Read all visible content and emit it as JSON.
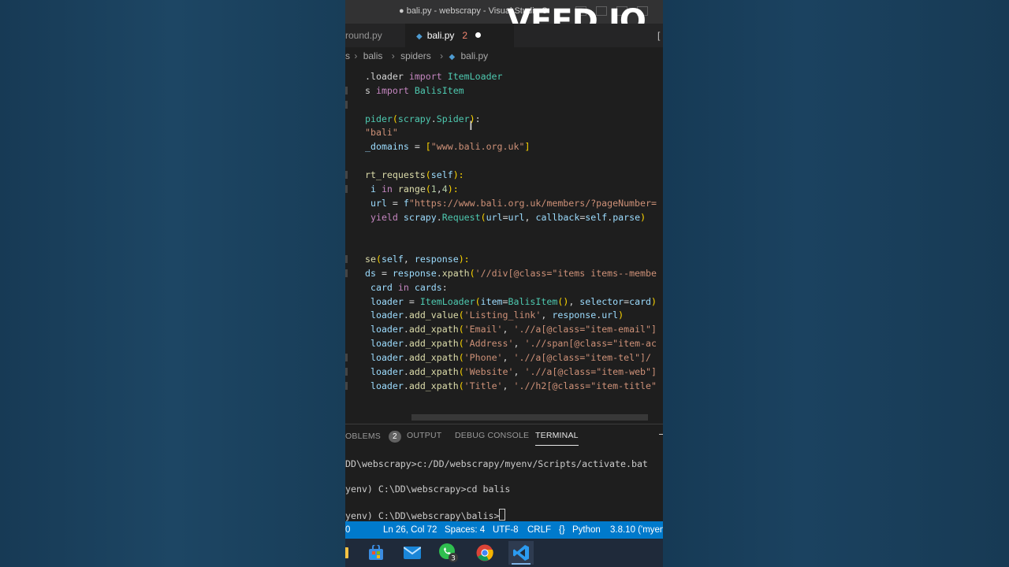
{
  "window": {
    "title": "● bali.py - webscrapy - Visual Studio C",
    "watermark": "VEED.IO"
  },
  "tabs": [
    {
      "label": "round.py",
      "active": false
    },
    {
      "label": "bali.py",
      "active": true,
      "errors": "2",
      "modified": true
    }
  ],
  "tab_overflow_glyph": "[",
  "breadcrumb": {
    "leading": "s",
    "parts": [
      "balis",
      "spiders",
      "bali.py"
    ]
  },
  "editor": {
    "lines": [
      [
        [
          ".loader ",
          "p"
        ],
        [
          "import ",
          "kw"
        ],
        [
          "ItemLoader",
          "cls"
        ]
      ],
      [
        [
          "s ",
          "p"
        ],
        [
          "import ",
          "kw"
        ],
        [
          "BalisItem",
          "cls"
        ]
      ],
      [],
      [
        [
          "pider",
          "cls"
        ],
        [
          "(",
          "y"
        ],
        [
          "scrapy",
          "cls"
        ],
        [
          ".",
          "p"
        ],
        [
          "Spider",
          "cls"
        ],
        [
          ")",
          "y"
        ],
        [
          ":",
          "p"
        ]
      ],
      [
        [
          "\"bali\"",
          "str"
        ]
      ],
      [
        [
          "_domains ",
          "var"
        ],
        [
          "= ",
          "p"
        ],
        [
          "[",
          "y"
        ],
        [
          "\"www.bali.org.uk\"",
          "str"
        ],
        [
          "]",
          "y"
        ]
      ],
      [],
      [
        [
          "rt_requests",
          "fn"
        ],
        [
          "(",
          "y"
        ],
        [
          "self",
          "var"
        ],
        [
          "):",
          "y"
        ]
      ],
      [
        [
          " i ",
          "var"
        ],
        [
          "in ",
          "kw"
        ],
        [
          "range",
          "fn"
        ],
        [
          "(",
          "y"
        ],
        [
          "1",
          "num"
        ],
        [
          ",",
          "p"
        ],
        [
          "4",
          "num"
        ],
        [
          "):",
          "y"
        ]
      ],
      [
        [
          " url ",
          "var"
        ],
        [
          "= ",
          "p"
        ],
        [
          "f",
          "var"
        ],
        [
          "\"https://www.bali.org.uk/members/?pageNumber=",
          "str"
        ]
      ],
      [
        [
          " yield ",
          "kw"
        ],
        [
          "scrapy",
          "var"
        ],
        [
          ".",
          "p"
        ],
        [
          "Request",
          "cls"
        ],
        [
          "(",
          "y"
        ],
        [
          "url",
          "var"
        ],
        [
          "=",
          "p"
        ],
        [
          "url",
          "var"
        ],
        [
          ", ",
          "p"
        ],
        [
          "callback",
          "var"
        ],
        [
          "=",
          "p"
        ],
        [
          "self",
          "var"
        ],
        [
          ".",
          "p"
        ],
        [
          "parse",
          "var"
        ],
        [
          ")",
          "y"
        ]
      ],
      [],
      [],
      [
        [
          "se",
          "fn"
        ],
        [
          "(",
          "y"
        ],
        [
          "self",
          "var"
        ],
        [
          ", ",
          "p"
        ],
        [
          "response",
          "var"
        ],
        [
          "):",
          "y"
        ]
      ],
      [
        [
          "ds ",
          "var"
        ],
        [
          "= ",
          "p"
        ],
        [
          "response",
          "var"
        ],
        [
          ".",
          "p"
        ],
        [
          "xpath",
          "fn"
        ],
        [
          "(",
          "y"
        ],
        [
          "'//div[@class=\"items items--membe",
          "str"
        ]
      ],
      [
        [
          " card ",
          "var"
        ],
        [
          "in ",
          "kw"
        ],
        [
          "cards",
          "var"
        ],
        [
          ":",
          "p"
        ]
      ],
      [
        [
          " loader ",
          "var"
        ],
        [
          "= ",
          "p"
        ],
        [
          "ItemLoader",
          "cls"
        ],
        [
          "(",
          "y"
        ],
        [
          "item",
          "var"
        ],
        [
          "=",
          "p"
        ],
        [
          "BalisItem",
          "cls"
        ],
        [
          "()",
          "y"
        ],
        [
          ", ",
          "p"
        ],
        [
          "selector",
          "var"
        ],
        [
          "=",
          "p"
        ],
        [
          "card",
          "var"
        ],
        [
          ")",
          "y"
        ]
      ],
      [
        [
          " loader",
          "var"
        ],
        [
          ".",
          "p"
        ],
        [
          "add_value",
          "fn"
        ],
        [
          "(",
          "y"
        ],
        [
          "'Listing_link'",
          "str"
        ],
        [
          ", ",
          "p"
        ],
        [
          "response",
          "var"
        ],
        [
          ".",
          "p"
        ],
        [
          "url",
          "var"
        ],
        [
          ")",
          "y"
        ]
      ],
      [
        [
          " loader",
          "var"
        ],
        [
          ".",
          "p"
        ],
        [
          "add_xpath",
          "fn"
        ],
        [
          "(",
          "y"
        ],
        [
          "'Email'",
          "str"
        ],
        [
          ", ",
          "p"
        ],
        [
          "'.//a[@class=\"item-email\"]",
          "str"
        ]
      ],
      [
        [
          " loader",
          "var"
        ],
        [
          ".",
          "p"
        ],
        [
          "add_xpath",
          "fn"
        ],
        [
          "(",
          "y"
        ],
        [
          "'Address'",
          "str"
        ],
        [
          ", ",
          "p"
        ],
        [
          "'.//span[@class=\"item-ac",
          "str"
        ]
      ],
      [
        [
          " loader",
          "var"
        ],
        [
          ".",
          "p"
        ],
        [
          "add_xpath",
          "fn"
        ],
        [
          "(",
          "y"
        ],
        [
          "'Phone'",
          "str"
        ],
        [
          ", ",
          "p"
        ],
        [
          "'.//a[@class=\"item-tel\"]/",
          "str"
        ]
      ],
      [
        [
          " loader",
          "var"
        ],
        [
          ".",
          "p"
        ],
        [
          "add_xpath",
          "fn"
        ],
        [
          "(",
          "y"
        ],
        [
          "'Website'",
          "str"
        ],
        [
          ", ",
          "p"
        ],
        [
          "'.//a[@class=\"item-web\"]",
          "str"
        ]
      ],
      [
        [
          " loader",
          "var"
        ],
        [
          ".",
          "p"
        ],
        [
          "add_xpath",
          "fn"
        ],
        [
          "(",
          "y"
        ],
        [
          "'Title'",
          "str"
        ],
        [
          ", ",
          "p"
        ],
        [
          "'.//h2[@class=\"item-title\"",
          "str"
        ]
      ]
    ]
  },
  "panel": {
    "tabs": [
      {
        "label": "OBLEMS",
        "badge": "2"
      },
      {
        "label": "OUTPUT"
      },
      {
        "label": "DEBUG CONSOLE"
      },
      {
        "label": "TERMINAL",
        "active": true
      }
    ],
    "terminal_lines": [
      "DD\\webscrapy>c:/DD/webscrapy/myenv/Scripts/activate.bat",
      "yenv) C:\\DD\\webscrapy>cd balis",
      "yenv) C:\\DD\\webscrapy\\balis>"
    ]
  },
  "statusbar": {
    "left_num": "0",
    "position": "Ln 26, Col 72",
    "spaces": "Spaces: 4",
    "encoding": "UTF-8",
    "eol": "CRLF",
    "language": "Python",
    "interpreter": "3.8.10 ('myenv"
  },
  "taskbar": {
    "items": [
      "file-explorer",
      "store",
      "mail",
      "whatsapp",
      "chrome",
      "vscode"
    ],
    "whatsapp_badge": "3"
  },
  "colors": {
    "accent": "#007acc",
    "editor_bg": "#1e1e1e",
    "tab_bg": "#252526",
    "titlebar_bg": "#323233"
  }
}
